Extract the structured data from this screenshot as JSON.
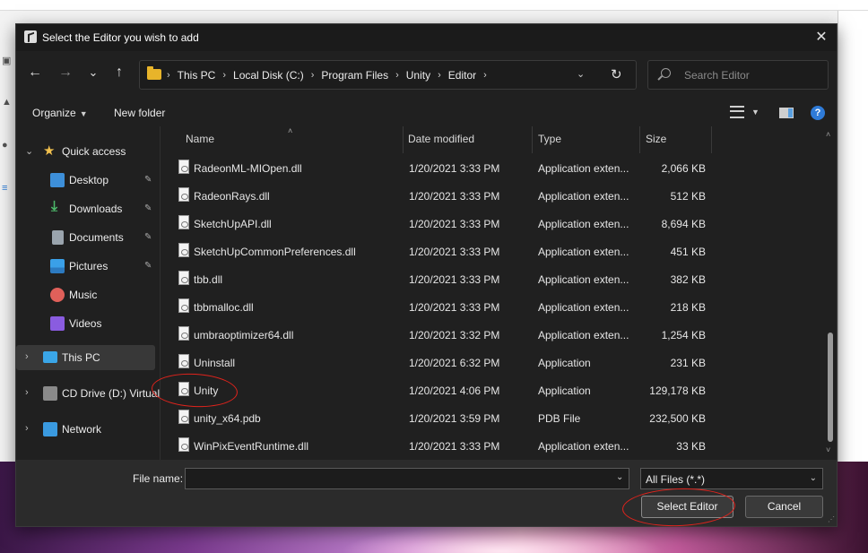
{
  "dialog": {
    "title": "Select the Editor you wish to add",
    "close_glyph": "✕"
  },
  "nav": {
    "back_glyph": "←",
    "forward_glyph": "→",
    "recent_glyph": "⌄",
    "up_glyph": "↑"
  },
  "address": {
    "crumbs": [
      "This PC",
      "Local Disk (C:)",
      "Program Files",
      "Unity",
      "Editor"
    ],
    "sep": "›",
    "drop_glyph": "⌄",
    "refresh_glyph": "↻"
  },
  "search": {
    "placeholder": "Search Editor"
  },
  "toolbar": {
    "organize_label": "Organize",
    "organize_caret": "▼",
    "new_folder_label": "New folder",
    "view_caret": "▼",
    "help_glyph": "?"
  },
  "sidebar": {
    "quick_access": "Quick access",
    "items": [
      {
        "label": "Desktop",
        "icon": "desktop-icon",
        "color": "#3d8fd9",
        "pinned": true
      },
      {
        "label": "Downloads",
        "icon": "download-icon",
        "color": "#4cb86a",
        "pinned": true
      },
      {
        "label": "Documents",
        "icon": "documents-icon",
        "color": "#9aa4ad",
        "pinned": true
      },
      {
        "label": "Pictures",
        "icon": "pictures-icon",
        "color": "#3aa0e8",
        "pinned": true
      },
      {
        "label": "Music",
        "icon": "music-icon",
        "color": "#e0605a",
        "pinned": false
      },
      {
        "label": "Videos",
        "icon": "videos-icon",
        "color": "#8a5ce0",
        "pinned": false
      }
    ],
    "this_pc": "This PC",
    "cd_drive": "CD Drive (D:) Virtual",
    "network": "Network",
    "pin_glyph": "📌",
    "chevron_down": "⌄",
    "chevron_right": "›"
  },
  "columns": {
    "name": "Name",
    "date": "Date modified",
    "type": "Type",
    "size": "Size",
    "sort_glyph": "˄"
  },
  "files": [
    {
      "name": "RadeonML-MIOpen.dll",
      "date": "1/20/2021 3:33 PM",
      "type": "Application exten...",
      "size": "2,066 KB"
    },
    {
      "name": "RadeonRays.dll",
      "date": "1/20/2021 3:33 PM",
      "type": "Application exten...",
      "size": "512 KB"
    },
    {
      "name": "SketchUpAPI.dll",
      "date": "1/20/2021 3:33 PM",
      "type": "Application exten...",
      "size": "8,694 KB"
    },
    {
      "name": "SketchUpCommonPreferences.dll",
      "date": "1/20/2021 3:33 PM",
      "type": "Application exten...",
      "size": "451 KB"
    },
    {
      "name": "tbb.dll",
      "date": "1/20/2021 3:33 PM",
      "type": "Application exten...",
      "size": "382 KB"
    },
    {
      "name": "tbbmalloc.dll",
      "date": "1/20/2021 3:33 PM",
      "type": "Application exten...",
      "size": "218 KB"
    },
    {
      "name": "umbraoptimizer64.dll",
      "date": "1/20/2021 3:32 PM",
      "type": "Application exten...",
      "size": "1,254 KB"
    },
    {
      "name": "Uninstall",
      "date": "1/20/2021 6:32 PM",
      "type": "Application",
      "size": "231 KB"
    },
    {
      "name": "Unity",
      "date": "1/20/2021 4:06 PM",
      "type": "Application",
      "size": "129,178 KB"
    },
    {
      "name": "unity_x64.pdb",
      "date": "1/20/2021 3:59 PM",
      "type": "PDB File",
      "size": "232,500 KB"
    },
    {
      "name": "WinPixEventRuntime.dll",
      "date": "1/20/2021 3:33 PM",
      "type": "Application exten...",
      "size": "33 KB"
    }
  ],
  "footer": {
    "file_name_label": "File name:",
    "file_name_value": "",
    "drop_glyph": "⌄",
    "filter": "All Files (*.*)",
    "filter_caret": "⌄",
    "select_label": "Select Editor",
    "cancel_label": "Cancel",
    "grip_glyph": "⋰"
  },
  "scroll": {
    "up_glyph": "˄",
    "down_glyph": "˅"
  }
}
